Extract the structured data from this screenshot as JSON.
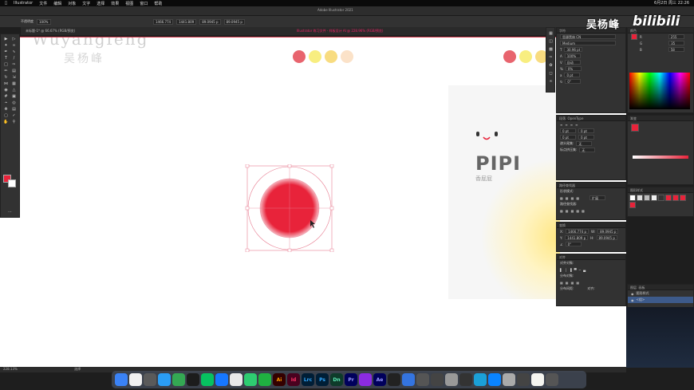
{
  "menubar": {
    "items": [
      "Illustrator",
      "文件",
      "编辑",
      "对象",
      "文字",
      "选择",
      "效果",
      "视图",
      "窗口",
      "帮助"
    ],
    "clock": "6月2日 周三 22:26"
  },
  "window_title": "Adobe Illustrator 2021",
  "options": {
    "mode": "不透明度",
    "opacity": "100%",
    "x": "1466.774",
    "y": "1441.809",
    "w": "89.0945 p",
    "h": "89.0945 p"
  },
  "tabs": {
    "tab1": "未标题-1* @ 66.67% (RGB/预览)",
    "tab2": "Illustrator 练习文件 - 样板设计 AI @ 228.96% (RGB/预览)"
  },
  "canvas": {
    "watermark_en": "Wuyangfeng",
    "watermark_cn": "吴杨峰",
    "card_title": "PIPI",
    "card_subtitle": "香屁屁"
  },
  "palette_left": [
    "#e8646e",
    "#f8ee80",
    "#f8dc80",
    "#fbe2c8"
  ],
  "palette_right": [
    "#e8646e",
    "#f8ee80",
    "#f8dc80"
  ],
  "main_circle_color": "#e8233a",
  "statusbar": {
    "zoom": "228.13%",
    "tool": "选择"
  },
  "char_panel": {
    "font": "思源黑体 CN",
    "style": "Medium",
    "size": "30.96 pt",
    "leading": "100%",
    "tracking": "自动",
    "scale": "0%",
    "shift": "0 pt",
    "angle": "0°"
  },
  "para_panel": {
    "header_left": "段落",
    "header_right": "OpenType",
    "indent_left": "0 pt",
    "indent_right": "0 pt",
    "space_before": "0 pt",
    "space_after": "0 pt",
    "hyphen": "避头尾集:",
    "hyphen_val": "无",
    "punct": "标点挤压集:",
    "punct_val": "无"
  },
  "color_panel": {
    "header": "颜色",
    "r": "255",
    "g": "35",
    "b": "58"
  },
  "pathfinder": {
    "header": "路径查找器",
    "shape_modes": "形状模式:",
    "pathfinders": "路径查找器:",
    "expand": "扩展"
  },
  "transform": {
    "header": "变换",
    "x": "1466.774 p",
    "y": "1441.809 p",
    "w": "89.0945 p",
    "h": "89.0945 p",
    "angle": "0°"
  },
  "align": {
    "header": "对齐",
    "align_objects": "对齐对象:",
    "distribute_objects": "分布对象:",
    "distribute_spacing": "分布间距:",
    "align_to": "对齐:"
  },
  "layers": {
    "header": "图层",
    "artboards": "画板",
    "layer1": "图形样式",
    "layer2": "<组>"
  },
  "gradient_header": "渐变",
  "brand": {
    "cn": "吴杨峰",
    "en": "bilibili"
  },
  "dock_icons": [
    {
      "label": "",
      "color": "#3a82f6"
    },
    {
      "label": "",
      "color": "#f0f0f0"
    },
    {
      "label": "",
      "color": "#5a5a5a"
    },
    {
      "label": "",
      "color": "#2a9df4"
    },
    {
      "label": "",
      "color": "#34a853"
    },
    {
      "label": "",
      "color": "#1c1c1c"
    },
    {
      "label": "",
      "color": "#07c160"
    },
    {
      "label": "",
      "color": "#1677ff"
    },
    {
      "label": "",
      "color": "#e8e8e8"
    },
    {
      "label": "",
      "color": "#2ecc71"
    },
    {
      "label": "",
      "color": "#1fb141"
    },
    {
      "label": "Ai",
      "color": "#330000"
    },
    {
      "label": "Id",
      "color": "#49021f"
    },
    {
      "label": "Lrc",
      "color": "#001e36"
    },
    {
      "label": "Ps",
      "color": "#001e36"
    },
    {
      "label": "Dn",
      "color": "#0e3b2a"
    },
    {
      "label": "Pr",
      "color": "#00005b"
    },
    {
      "label": "",
      "color": "#8b2be2"
    },
    {
      "label": "Ae",
      "color": "#00005b"
    },
    {
      "label": "",
      "color": "#222"
    },
    {
      "label": "",
      "color": "#3474e0"
    },
    {
      "label": "",
      "color": "#555"
    },
    {
      "label": "",
      "color": "#444"
    },
    {
      "label": "",
      "color": "#999"
    },
    {
      "label": "",
      "color": "#333"
    },
    {
      "label": "",
      "color": "#1ba0d8"
    },
    {
      "label": "",
      "color": "#0a84ff"
    },
    {
      "label": "",
      "color": "#aaa"
    },
    {
      "label": "",
      "color": "#444"
    },
    {
      "label": "",
      "color": "#f5f5f0"
    },
    {
      "label": "",
      "color": "#555"
    }
  ]
}
